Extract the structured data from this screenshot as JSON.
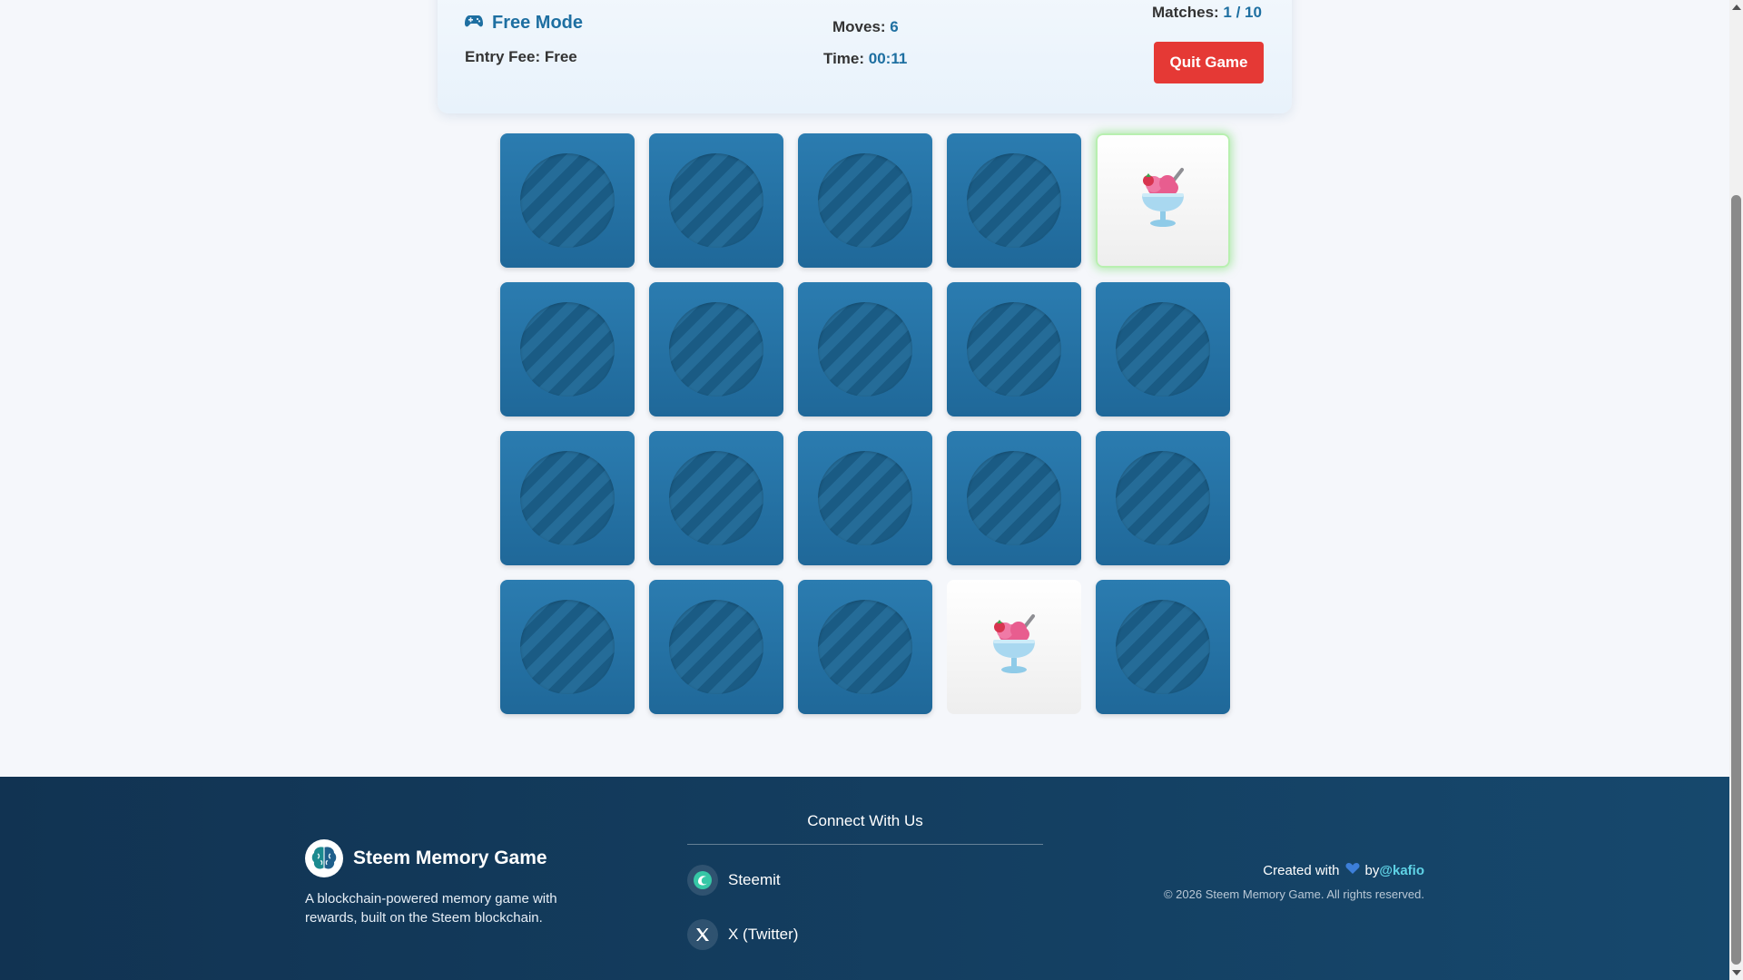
{
  "game": {
    "mode_label": "Free Mode",
    "entry_fee": "Entry Fee: Free",
    "moves_label": "Moves: ",
    "moves_value": "6",
    "time_label": "Time: ",
    "time_value": "00:11",
    "matches_label": "Matches: ",
    "matches_value": "1 / 10",
    "quit_label": "Quit Game"
  },
  "board": {
    "rows": 4,
    "columns": 5,
    "cards": [
      {
        "state": "hidden"
      },
      {
        "state": "hidden"
      },
      {
        "state": "hidden"
      },
      {
        "state": "hidden"
      },
      {
        "state": "revealed",
        "icon": "ice-cream-sundae-icon",
        "highlight": true
      },
      {
        "state": "hidden"
      },
      {
        "state": "hidden"
      },
      {
        "state": "hidden"
      },
      {
        "state": "hidden"
      },
      {
        "state": "hidden"
      },
      {
        "state": "hidden"
      },
      {
        "state": "hidden"
      },
      {
        "state": "hidden"
      },
      {
        "state": "hidden"
      },
      {
        "state": "hidden"
      },
      {
        "state": "hidden"
      },
      {
        "state": "hidden"
      },
      {
        "state": "hidden"
      },
      {
        "state": "revealed",
        "icon": "ice-cream-sundae-icon",
        "highlight": false
      },
      {
        "state": "hidden"
      }
    ]
  },
  "footer": {
    "brand_name": "Steem Memory Game",
    "brand_description": "A blockchain-powered memory game with rewards, built on the Steem blockchain.",
    "connect_title": "Connect With Us",
    "social": [
      {
        "label": "Steemit",
        "icon": "steemit-icon"
      },
      {
        "label": "X (Twitter)",
        "icon": "x-twitter-icon"
      }
    ],
    "credit_prefix": "Created with",
    "credit_by": "by",
    "credit_author": "@kafio",
    "copyright": "© 2026 Steem Memory Game. All rights reserved."
  },
  "colors": {
    "accent": "#1e6fa1",
    "quit_button": "#e53935",
    "card_back": "#2478ab",
    "footer_bg": "#133d5f",
    "author_link": "#5fd3e6",
    "match_glow": "#a6ec9c"
  }
}
